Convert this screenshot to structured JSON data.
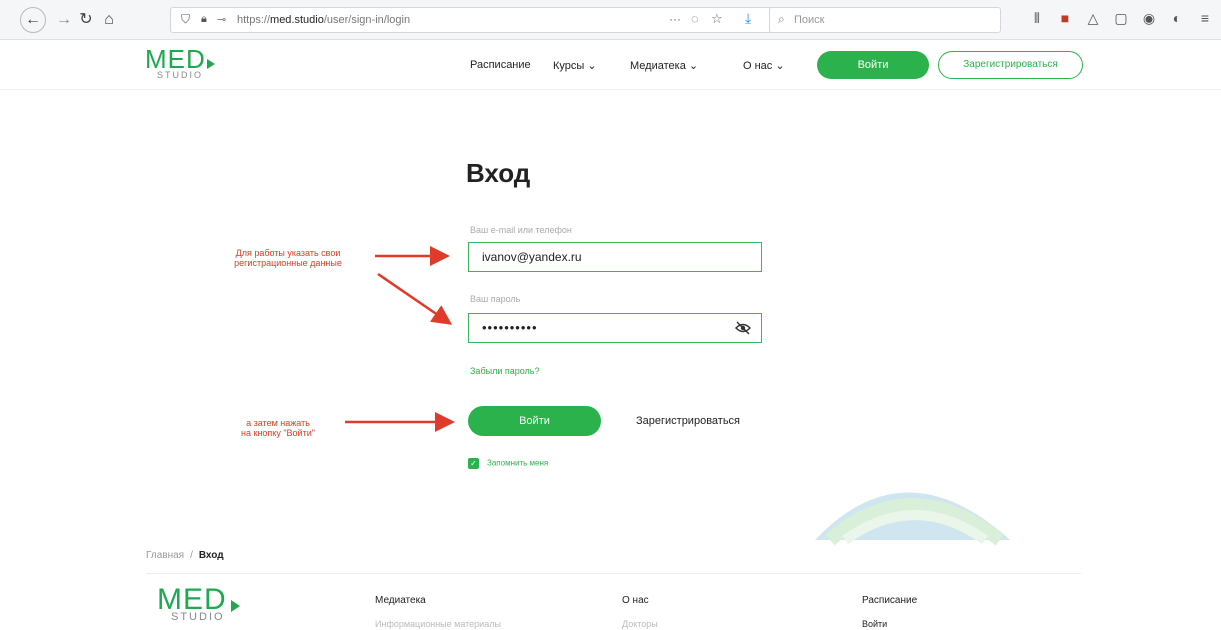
{
  "browser": {
    "url_prefix": "https://",
    "url_domain": "med.studio",
    "url_path": "/user/sign-in/login",
    "search_placeholder": "Поиск"
  },
  "header": {
    "nav": [
      {
        "label": "Расписание"
      },
      {
        "label": "Курсы ⌄"
      },
      {
        "label": "Медиатека ⌄"
      },
      {
        "label": "О нас ⌄"
      }
    ],
    "login_label": "Войти",
    "register_label": "Зарегистрироваться"
  },
  "logo": {
    "med": "MED",
    "studio": "STUDIO"
  },
  "form": {
    "title": "Вход",
    "email_label": "Ваш e-mail или телефон",
    "email_value": "ivanov@yandex.ru",
    "password_label": "Ваш пароль",
    "password_value": "••••••••••",
    "forgot_label": "Забыли пароль?",
    "submit_label": "Войти",
    "register_link": "Зарегистрироваться",
    "remember_label": "Запомнить меня",
    "remember_checked": true
  },
  "annotations": {
    "note1_line1": "Для работы указать свои",
    "note1_line2": "регистрационные данные",
    "note2_line1": "а затем нажать",
    "note2_line2": "на кнопку \"Войти\""
  },
  "breadcrumb": {
    "home": "Главная",
    "sep": "/",
    "current": "Вход"
  },
  "footer": {
    "col1_title": "Медиатека",
    "col2_title": "О нас",
    "col3_title": "Расписание",
    "col1_sub": "Информационные материалы",
    "col2_sub": "Докторы",
    "col3_sub": "Войти"
  },
  "colors": {
    "brand_green": "#2bb24c",
    "annotation_red": "#e03a2a"
  }
}
